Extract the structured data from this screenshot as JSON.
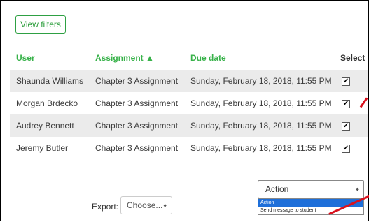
{
  "filters": {
    "view_filters_label": "View filters"
  },
  "table": {
    "headers": {
      "user": "User",
      "assignment": "Assignment ▲",
      "due_date": "Due date",
      "select": "Select"
    },
    "rows": [
      {
        "user": "Shaunda Williams",
        "assignment": "Chapter 3 Assignment",
        "due_date": "Sunday, February 18, 2018, 11:55 PM",
        "checked": "✔"
      },
      {
        "user": "Morgan Brdecko",
        "assignment": "Chapter 3 Assignment",
        "due_date": "Sunday, February 18, 2018, 11:55 PM",
        "checked": "✔"
      },
      {
        "user": "Audrey Bennett",
        "assignment": "Chapter 3 Assignment",
        "due_date": "Sunday, February 18, 2018, 11:55 PM",
        "checked": "✔"
      },
      {
        "user": "Jeremy Butler",
        "assignment": "Chapter 3 Assignment",
        "due_date": "Sunday, February 18, 2018, 11:55 PM",
        "checked": "✔"
      }
    ]
  },
  "export": {
    "label": "Export:",
    "selected": "Choose...",
    "caret": "♦"
  },
  "action": {
    "selected": "Action",
    "caret": "♦",
    "options": [
      "Action",
      "Send message to student"
    ]
  },
  "colors": {
    "accent_green": "#38b24a",
    "annotation_red": "#d9111d",
    "highlight_blue": "#1e6fd9"
  }
}
